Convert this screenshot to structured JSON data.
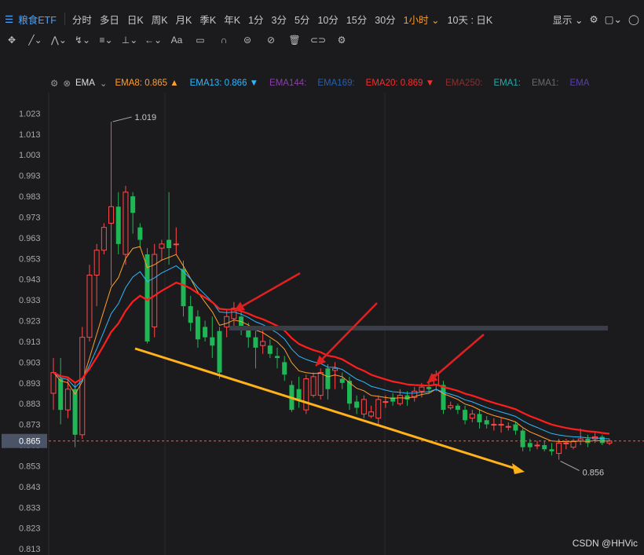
{
  "topbar": {
    "symbol": "粮食ETF",
    "tabs": [
      "分时",
      "多日",
      "日K",
      "周K",
      "月K",
      "季K",
      "年K",
      "1分",
      "3分",
      "5分",
      "10分",
      "15分",
      "30分",
      "1小时",
      "10天 : 日K"
    ],
    "active_tab": "1小时",
    "display_label": "显示"
  },
  "indicator": {
    "name": "EMA",
    "items": [
      {
        "label": "EMA8:",
        "value": "0.865",
        "color": "#ff9f2f",
        "arrow": "▲"
      },
      {
        "label": "EMA13:",
        "value": "0.866",
        "color": "#2fb7ff",
        "arrow": "▼"
      },
      {
        "label": "EMA144:",
        "value": "",
        "color": "#8a3fa8",
        "arrow": ""
      },
      {
        "label": "EMA169:",
        "value": "",
        "color": "#2a5fa8",
        "arrow": ""
      },
      {
        "label": "EMA20:",
        "value": "0.869",
        "color": "#ff2a2a",
        "arrow": "▼"
      },
      {
        "label": "EMA250:",
        "value": "",
        "color": "#8a3030",
        "arrow": ""
      },
      {
        "label": "EMA1:",
        "value": "",
        "color": "#2aa8a8",
        "arrow": ""
      },
      {
        "label": "EMA1:",
        "value": "",
        "color": "#6a6a6a",
        "arrow": ""
      },
      {
        "label": "EMA",
        "value": "",
        "color": "#5a3fa8",
        "arrow": ""
      }
    ]
  },
  "chart_data": {
    "type": "candlestick",
    "ylim": [
      0.81,
      1.033
    ],
    "yticks": [
      "1.023",
      "1.013",
      "1.003",
      "0.993",
      "0.983",
      "0.973",
      "0.963",
      "0.953",
      "0.943",
      "0.933",
      "0.923",
      "0.913",
      "0.903",
      "0.893",
      "0.883",
      "0.873",
      "0.863",
      "0.853",
      "0.843",
      "0.833",
      "0.823",
      "0.813"
    ],
    "current_price_label": "0.865",
    "current_price": 0.865,
    "high_label": "1.019",
    "high_value": 1.019,
    "low_label": "0.856",
    "low_value": 0.856,
    "candles": [
      [
        0.888,
        0.898,
        0.88,
        0.905
      ],
      [
        0.895,
        0.88,
        0.873,
        0.905
      ],
      [
        0.88,
        0.89,
        0.876,
        0.895
      ],
      [
        0.89,
        0.868,
        0.862,
        0.893
      ],
      [
        0.868,
        0.915,
        0.866,
        0.92
      ],
      [
        0.915,
        0.945,
        0.913,
        0.95
      ],
      [
        0.945,
        0.957,
        0.93,
        0.96
      ],
      [
        0.957,
        0.968,
        0.955,
        0.97
      ],
      [
        0.97,
        0.978,
        0.94,
        1.019
      ],
      [
        0.978,
        0.96,
        0.955,
        0.985
      ],
      [
        0.955,
        0.985,
        0.95,
        0.988
      ],
      [
        0.983,
        0.975,
        0.965,
        0.985
      ],
      [
        0.968,
        0.962,
        0.958,
        0.97
      ],
      [
        0.955,
        0.913,
        0.912,
        0.958
      ],
      [
        0.92,
        0.955,
        0.915,
        0.96
      ],
      [
        0.958,
        0.96,
        0.952,
        0.962
      ],
      [
        0.962,
        0.958,
        0.95,
        0.985
      ],
      [
        0.96,
        0.96,
        0.955,
        0.968
      ],
      [
        0.948,
        0.93,
        0.925,
        0.952
      ],
      [
        0.93,
        0.922,
        0.918,
        0.935
      ],
      [
        0.925,
        0.914,
        0.91,
        0.928
      ],
      [
        0.92,
        0.915,
        0.913,
        0.923
      ],
      [
        0.915,
        0.911,
        0.905,
        0.925
      ],
      [
        0.918,
        0.898,
        0.895,
        0.92
      ],
      [
        0.92,
        0.925,
        0.915,
        0.928
      ],
      [
        0.924,
        0.929,
        0.92,
        0.932
      ],
      [
        0.925,
        0.92,
        0.916,
        0.928
      ],
      [
        0.919,
        0.915,
        0.91,
        0.922
      ],
      [
        0.915,
        0.91,
        0.9,
        0.918
      ],
      [
        0.911,
        0.913,
        0.907,
        0.919
      ],
      [
        0.911,
        0.907,
        0.905,
        0.914
      ],
      [
        0.906,
        0.905,
        0.9,
        0.91
      ],
      [
        0.903,
        0.897,
        0.894,
        0.906
      ],
      [
        0.892,
        0.88,
        0.879,
        0.894
      ],
      [
        0.89,
        0.885,
        0.881,
        0.896
      ],
      [
        0.88,
        0.895,
        0.878,
        0.897
      ],
      [
        0.887,
        0.896,
        0.886,
        0.898
      ],
      [
        0.887,
        0.898,
        0.885,
        0.9
      ],
      [
        0.9,
        0.89,
        0.885,
        0.902
      ],
      [
        0.899,
        0.9,
        0.89,
        0.903
      ],
      [
        0.895,
        0.893,
        0.89,
        0.898
      ],
      [
        0.894,
        0.883,
        0.88,
        0.896
      ],
      [
        0.884,
        0.881,
        0.878,
        0.887
      ],
      [
        0.878,
        0.885,
        0.876,
        0.887
      ],
      [
        0.877,
        0.879,
        0.876,
        0.882
      ],
      [
        0.876,
        0.885,
        0.873,
        0.887
      ],
      [
        0.884,
        0.884,
        0.881,
        0.887
      ],
      [
        0.886,
        0.884,
        0.882,
        0.888
      ],
      [
        0.883,
        0.887,
        0.882,
        0.89
      ],
      [
        0.887,
        0.885,
        0.882,
        0.889
      ],
      [
        0.886,
        0.889,
        0.884,
        0.891
      ],
      [
        0.889,
        0.891,
        0.886,
        0.893
      ],
      [
        0.891,
        0.89,
        0.888,
        0.894
      ],
      [
        0.892,
        0.897,
        0.889,
        0.899
      ],
      [
        0.892,
        0.88,
        0.878,
        0.894
      ],
      [
        0.881,
        0.882,
        0.88,
        0.884
      ],
      [
        0.882,
        0.88,
        0.878,
        0.883
      ],
      [
        0.88,
        0.875,
        0.873,
        0.882
      ],
      [
        0.876,
        0.878,
        0.874,
        0.88
      ],
      [
        0.878,
        0.874,
        0.871,
        0.88
      ],
      [
        0.875,
        0.873,
        0.871,
        0.877
      ],
      [
        0.873,
        0.873,
        0.87,
        0.876
      ],
      [
        0.873,
        0.873,
        0.869,
        0.876
      ],
      [
        0.872,
        0.872,
        0.87,
        0.874
      ],
      [
        0.873,
        0.87,
        0.868,
        0.874
      ],
      [
        0.87,
        0.862,
        0.86,
        0.871
      ],
      [
        0.864,
        0.862,
        0.86,
        0.866
      ],
      [
        0.863,
        0.863,
        0.861,
        0.865
      ],
      [
        0.863,
        0.861,
        0.86,
        0.865
      ],
      [
        0.861,
        0.86,
        0.858,
        0.864
      ],
      [
        0.859,
        0.864,
        0.856,
        0.866
      ],
      [
        0.864,
        0.864,
        0.861,
        0.866
      ],
      [
        0.862,
        0.865,
        0.861,
        0.866
      ],
      [
        0.865,
        0.866,
        0.863,
        0.871
      ],
      [
        0.866,
        0.864,
        0.862,
        0.868
      ],
      [
        0.866,
        0.867,
        0.864,
        0.869
      ],
      [
        0.867,
        0.864,
        0.863,
        0.868
      ],
      [
        0.864,
        0.865,
        0.863,
        0.866
      ]
    ]
  },
  "watermark": "CSDN @HHVic"
}
